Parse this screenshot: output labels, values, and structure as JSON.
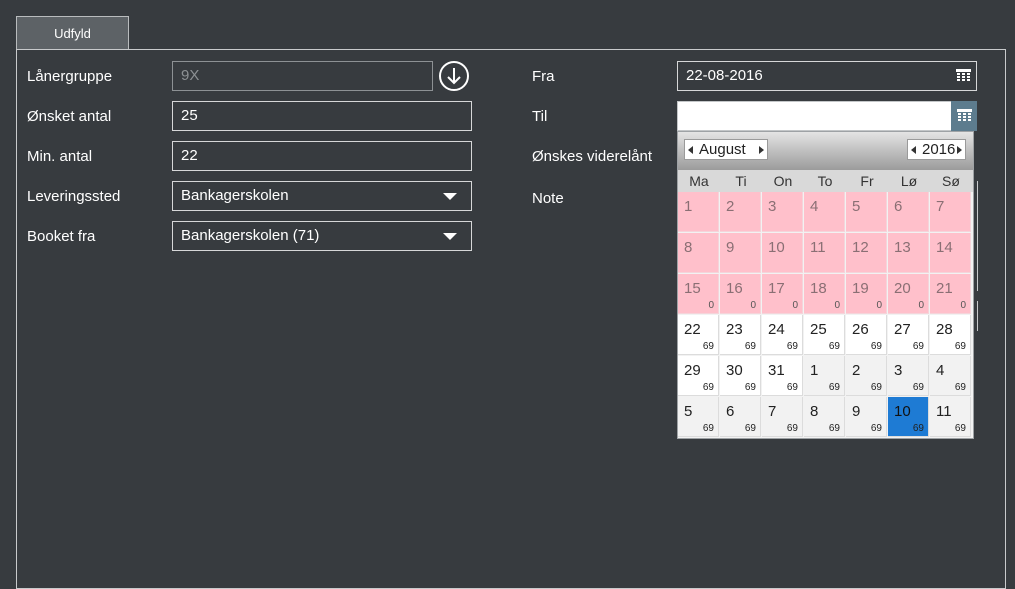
{
  "tab": {
    "label": "Udfyld"
  },
  "left": {
    "lanergruppe_label": "Lånergruppe",
    "lanergruppe_value": "9X",
    "onsket_label": "Ønsket antal",
    "onsket_value": "25",
    "min_label": "Min. antal",
    "min_value": "22",
    "levering_label": "Leveringssted",
    "levering_value": "Bankagerskolen",
    "booket_label": "Booket fra",
    "booket_value": "Bankagerskolen (71)"
  },
  "right": {
    "fra_label": "Fra",
    "fra_value": "22-08-2016",
    "til_label": "Til",
    "til_value": "",
    "videre_label": "Ønskes viderelånt",
    "note_label": "Note"
  },
  "calendar": {
    "month": "August",
    "year": "2016",
    "weekdays": [
      "Ma",
      "Ti",
      "On",
      "To",
      "Fr",
      "Lø",
      "Sø"
    ],
    "days": [
      {
        "n": "1",
        "c": "",
        "s": "past"
      },
      {
        "n": "2",
        "c": "",
        "s": "past"
      },
      {
        "n": "3",
        "c": "",
        "s": "past"
      },
      {
        "n": "4",
        "c": "",
        "s": "past"
      },
      {
        "n": "5",
        "c": "",
        "s": "past"
      },
      {
        "n": "6",
        "c": "",
        "s": "past"
      },
      {
        "n": "7",
        "c": "",
        "s": "past"
      },
      {
        "n": "8",
        "c": "",
        "s": "past"
      },
      {
        "n": "9",
        "c": "",
        "s": "past"
      },
      {
        "n": "10",
        "c": "",
        "s": "past"
      },
      {
        "n": "11",
        "c": "",
        "s": "past"
      },
      {
        "n": "12",
        "c": "",
        "s": "past"
      },
      {
        "n": "13",
        "c": "",
        "s": "past"
      },
      {
        "n": "14",
        "c": "",
        "s": "past"
      },
      {
        "n": "15",
        "c": "0",
        "s": "past"
      },
      {
        "n": "16",
        "c": "0",
        "s": "past"
      },
      {
        "n": "17",
        "c": "0",
        "s": "past"
      },
      {
        "n": "18",
        "c": "0",
        "s": "past"
      },
      {
        "n": "19",
        "c": "0",
        "s": "past"
      },
      {
        "n": "20",
        "c": "0",
        "s": "past"
      },
      {
        "n": "21",
        "c": "0",
        "s": "past"
      },
      {
        "n": "22",
        "c": "69",
        "s": "cur"
      },
      {
        "n": "23",
        "c": "69",
        "s": "cur"
      },
      {
        "n": "24",
        "c": "69",
        "s": "cur"
      },
      {
        "n": "25",
        "c": "69",
        "s": "cur"
      },
      {
        "n": "26",
        "c": "69",
        "s": "cur"
      },
      {
        "n": "27",
        "c": "69",
        "s": "cur"
      },
      {
        "n": "28",
        "c": "69",
        "s": "cur"
      },
      {
        "n": "29",
        "c": "69",
        "s": "cur"
      },
      {
        "n": "30",
        "c": "69",
        "s": "cur"
      },
      {
        "n": "31",
        "c": "69",
        "s": "cur"
      },
      {
        "n": "1",
        "c": "69",
        "s": "next"
      },
      {
        "n": "2",
        "c": "69",
        "s": "next"
      },
      {
        "n": "3",
        "c": "69",
        "s": "next"
      },
      {
        "n": "4",
        "c": "69",
        "s": "next"
      },
      {
        "n": "5",
        "c": "69",
        "s": "next"
      },
      {
        "n": "6",
        "c": "69",
        "s": "next"
      },
      {
        "n": "7",
        "c": "69",
        "s": "next"
      },
      {
        "n": "8",
        "c": "69",
        "s": "next"
      },
      {
        "n": "9",
        "c": "69",
        "s": "next"
      },
      {
        "n": "10",
        "c": "69",
        "s": "sel"
      },
      {
        "n": "11",
        "c": "69",
        "s": "next"
      }
    ]
  },
  "colors": {
    "background": "#373b3f",
    "past_day": "#ffc0cb",
    "selected_day": "#1e7bd4"
  }
}
